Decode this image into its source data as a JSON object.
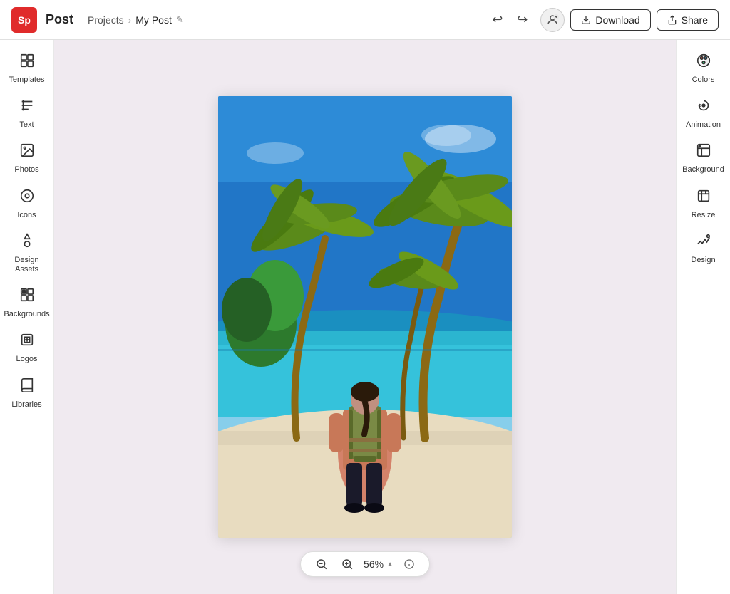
{
  "app": {
    "logo": "Sp",
    "name": "Post"
  },
  "breadcrumb": {
    "projects": "Projects",
    "separator": "›",
    "current": "My Post",
    "edit_icon": "✎"
  },
  "topbar": {
    "undo_icon": "↩",
    "redo_icon": "↪",
    "download_label": "Download",
    "share_label": "Share",
    "download_icon": "⬇",
    "share_icon": "↗"
  },
  "left_sidebar": {
    "items": [
      {
        "id": "templates",
        "label": "Templates",
        "icon": "grid"
      },
      {
        "id": "text",
        "label": "Text",
        "icon": "text"
      },
      {
        "id": "photos",
        "label": "Photos",
        "icon": "photo"
      },
      {
        "id": "icons",
        "label": "Icons",
        "icon": "circle"
      },
      {
        "id": "design-assets",
        "label": "Design Assets",
        "icon": "diamond"
      },
      {
        "id": "backgrounds",
        "label": "Backgrounds",
        "icon": "squares"
      },
      {
        "id": "logos",
        "label": "Logos",
        "icon": "shield"
      },
      {
        "id": "libraries",
        "label": "Libraries",
        "icon": "book"
      }
    ]
  },
  "right_sidebar": {
    "items": [
      {
        "id": "colors",
        "label": "Colors",
        "icon": "palette"
      },
      {
        "id": "animation",
        "label": "Animation",
        "icon": "animation"
      },
      {
        "id": "background",
        "label": "Background",
        "icon": "background"
      },
      {
        "id": "resize",
        "label": "Resize",
        "icon": "resize"
      },
      {
        "id": "design",
        "label": "Design",
        "icon": "design"
      }
    ]
  },
  "zoom": {
    "zoom_out_label": "Zoom out",
    "zoom_in_label": "Zoom in",
    "value": "56%",
    "chevron": "▲",
    "info": "ℹ"
  }
}
